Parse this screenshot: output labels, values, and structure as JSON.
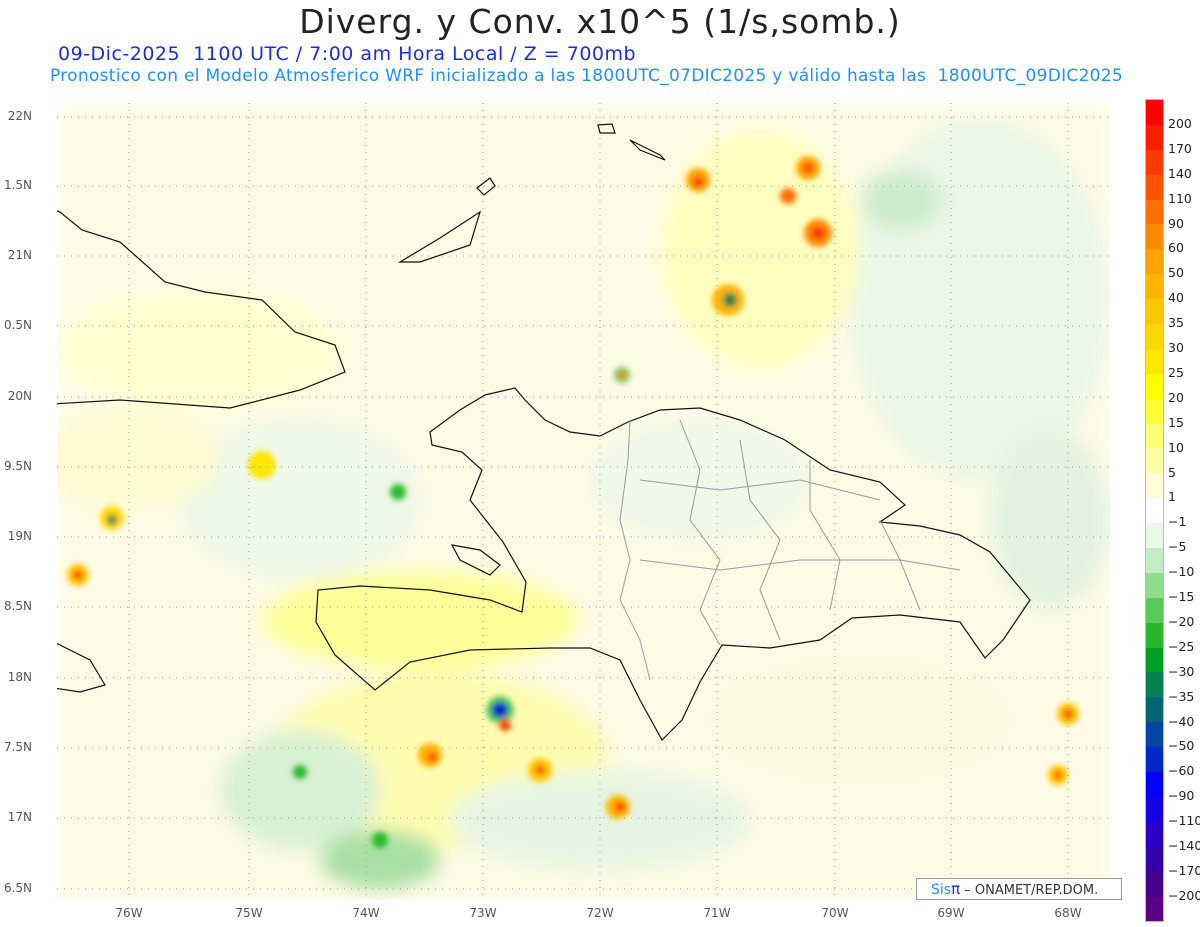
{
  "header": {
    "title": "Diverg. y Conv. x10^5 (1/s,somb.)",
    "subtitle": "09-Dic-2025  1100 UTC / 7:00 am Hora Local / Z = 700mb",
    "forecast_note": "Pronostico con el Modelo Atmosferico WRF inicializado a las 1800UTC_07DIC2025 y válido hasta las  1800UTC_09DIC2025"
  },
  "map": {
    "lat_labels": [
      "22N",
      "1.5N",
      "21N",
      "0.5N",
      "20N",
      "9.5N",
      "19N",
      "8.5N",
      "18N",
      "7.5N",
      "17N",
      "6.5N"
    ],
    "lon_labels": [
      "76W",
      "75W",
      "74W",
      "73W",
      "72W",
      "71W",
      "70W",
      "69W",
      "68W"
    ]
  },
  "colorbar": {
    "labels": [
      "200",
      "170",
      "140",
      "110",
      "90",
      "60",
      "50",
      "40",
      "35",
      "30",
      "25",
      "20",
      "15",
      "10",
      "5",
      "1",
      "−1",
      "−5",
      "−10",
      "−15",
      "−20",
      "−25",
      "−30",
      "−35",
      "−40",
      "−50",
      "−60",
      "−90",
      "−110",
      "−140",
      "−170",
      "−200"
    ],
    "colors": [
      "#ff0000",
      "#ff1e00",
      "#ff3a00",
      "#ff5200",
      "#ff6e00",
      "#ff8a00",
      "#ffa200",
      "#ffb400",
      "#ffc800",
      "#ffd800",
      "#ffe600",
      "#ffff00",
      "#ffff3a",
      "#ffff78",
      "#ffffa8",
      "#ffffd6",
      "#ffffff",
      "#ecf7ec",
      "#c2ecc2",
      "#8ddd8d",
      "#5ac85a",
      "#2ab82a",
      "#00a028",
      "#008250",
      "#006478",
      "#0046a0",
      "#0028c8",
      "#0000ff",
      "#1400e6",
      "#2800c8",
      "#3200aa",
      "#46008c",
      "#5a0082"
    ]
  },
  "credit": {
    "brand": "Sis",
    "brand_symbol": "π",
    "org": " – ONAMET/REP.DOM."
  }
}
